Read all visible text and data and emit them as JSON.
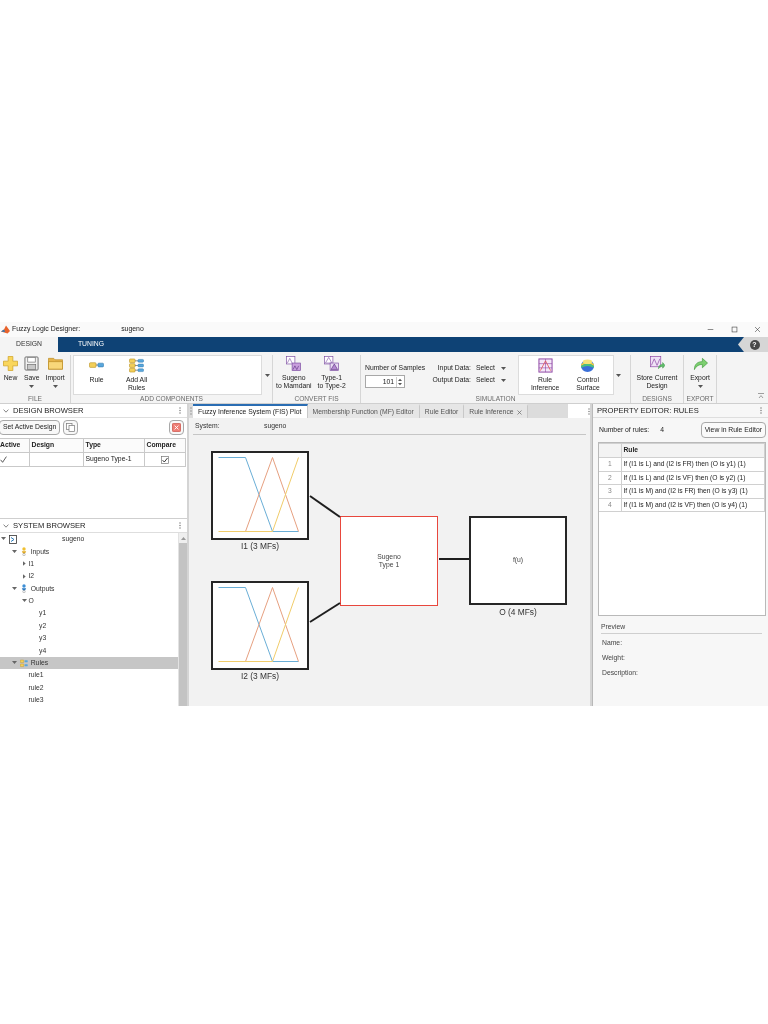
{
  "window": {
    "title": "Fuzzy Logic Designer:",
    "document": "sugeno"
  },
  "ribbon_tabs": [
    {
      "label": "DESIGN",
      "selected": true
    },
    {
      "label": "TUNING",
      "selected": false
    }
  ],
  "help": "?",
  "toolstrip": [
    {
      "title": "FILE",
      "items": [
        {
          "kind": "button",
          "label": "New",
          "dropdown": false
        },
        {
          "kind": "button",
          "label": "Save",
          "dropdown": true
        },
        {
          "kind": "button",
          "label": "Import",
          "dropdown": true
        }
      ]
    },
    {
      "title": "ADD COMPONENTS",
      "gallery": [
        {
          "label": "Rule"
        },
        {
          "label": "Add All\nRules"
        }
      ]
    },
    {
      "title": "CONVERT FIS",
      "items": [
        {
          "kind": "button",
          "label": "Sugeno\nto Mamdani",
          "dropdown": false
        },
        {
          "kind": "button",
          "label": "Type-1\nto Type-2",
          "dropdown": false
        }
      ]
    },
    {
      "title": "SIMULATION",
      "items": [
        {
          "kind": "spinner",
          "label": "Number of Samples",
          "value": "101"
        },
        {
          "kind": "select",
          "label": "Input Data:",
          "value": "Select"
        },
        {
          "kind": "select",
          "label": "Output Data:",
          "value": "Select"
        }
      ],
      "gallery": [
        {
          "label": "Rule\nInference"
        },
        {
          "label": "Control\nSurface"
        }
      ]
    },
    {
      "title": "DESIGNS",
      "items": [
        {
          "kind": "button",
          "label": "Store Current\nDesign",
          "dropdown": false
        }
      ]
    },
    {
      "title": "EXPORT",
      "items": [
        {
          "kind": "button",
          "label": "Export",
          "dropdown": true
        }
      ]
    }
  ],
  "design_browser": {
    "title": "DESIGN BROWSER",
    "set_active_button": "Set Active Design",
    "table": {
      "columns": [
        "Active",
        "Design",
        "Type",
        "Compare"
      ],
      "rows": [
        {
          "active": true,
          "type": "Sugeno Type-1",
          "compare": true
        }
      ]
    }
  },
  "system_browser": {
    "title": "SYSTEM BROWSER",
    "tree": [
      {
        "label": "sugeno",
        "kind": "system",
        "expanded": true,
        "selected": false,
        "children": [
          {
            "label": "Inputs",
            "kind": "inputs",
            "expanded": true,
            "selected": false,
            "children": [
              {
                "label": "I1",
                "expanded": false,
                "selected": false
              },
              {
                "label": "I2",
                "expanded": false,
                "selected": false
              }
            ]
          },
          {
            "label": "Outputs",
            "kind": "outputs",
            "expanded": true,
            "selected": false,
            "children": [
              {
                "label": "O",
                "expanded": true,
                "selected": false,
                "children": [
                  {
                    "label": "y1",
                    "selected": false
                  },
                  {
                    "label": "y2",
                    "selected": false
                  },
                  {
                    "label": "y3",
                    "selected": false
                  },
                  {
                    "label": "y4",
                    "selected": false
                  }
                ]
              }
            ]
          },
          {
            "label": "Rules",
            "kind": "rules",
            "expanded": true,
            "selected": true,
            "children": [
              {
                "label": "rule1",
                "selected": false
              },
              {
                "label": "rule2",
                "selected": false
              },
              {
                "label": "rule3",
                "selected": false
              }
            ]
          }
        ]
      }
    ]
  },
  "document_tabs": [
    {
      "label": "Fuzzy Inference System (FIS) Plot",
      "selected": true,
      "closable": false
    },
    {
      "label": "Membership Function (MF) Editor",
      "selected": false,
      "closable": false
    },
    {
      "label": "Rule Editor",
      "selected": false,
      "closable": false
    },
    {
      "label": "Rule Inference",
      "selected": false,
      "closable": true
    }
  ],
  "fis_plot": {
    "system_label": "System:",
    "system_name": "sugeno",
    "inputs": [
      {
        "label": "I1 (3 MFs)"
      },
      {
        "label": "I2 (3 MFs)"
      }
    ],
    "engine": {
      "label": "Sugeno\nType 1"
    },
    "output": {
      "function": "f(u)",
      "label": "O (4 MFs)"
    }
  },
  "property_editor": {
    "title": "PROPERTY EDITOR: RULES",
    "count_label": "Number of rules:",
    "count": "4",
    "view_button": "View in Rule Editor",
    "table": {
      "columns": [
        "Rule"
      ],
      "rows": [
        {
          "index": "1",
          "rule": "If (I1 is L) and (I2 is FR) then (O is y1) (1)"
        },
        {
          "index": "2",
          "rule": "If (I1 is L) and (I2 is VF) then (O is y2) (1)"
        },
        {
          "index": "3",
          "rule": "If (I1 is M) and (I2 is FR) then (O is y3) (1)"
        },
        {
          "index": "4",
          "rule": "If (I1 is M) and (I2 is VF) then (O is y4) (1)"
        }
      ]
    },
    "preview": {
      "title": "Preview",
      "fields": [
        "Name:",
        "Weight:",
        "Description:"
      ]
    }
  }
}
